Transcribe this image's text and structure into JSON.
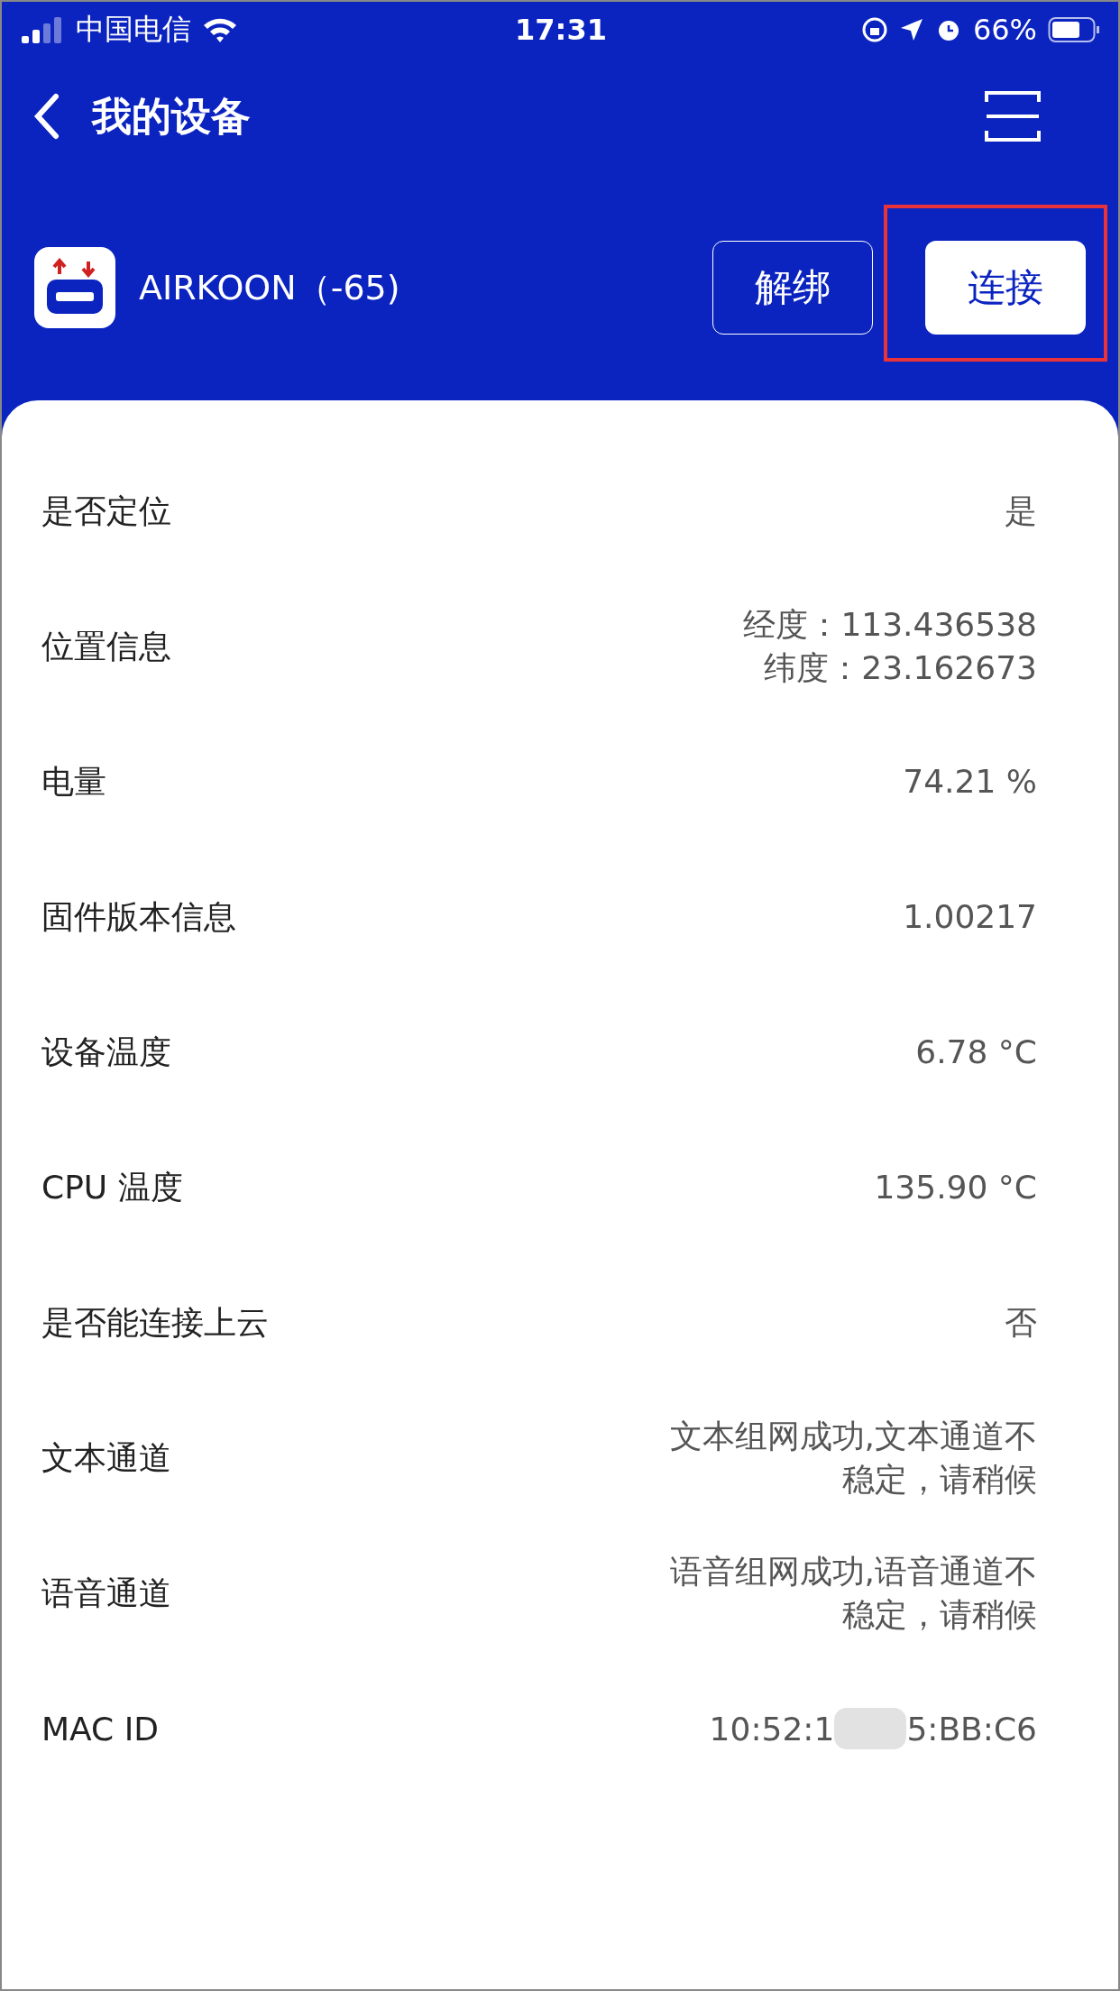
{
  "status_bar": {
    "carrier": "中国电信",
    "time": "17:31",
    "battery": "66%"
  },
  "nav": {
    "title": "我的设备"
  },
  "device": {
    "name": "AIRKOON（-65)",
    "buttons": [
      {
        "label": "解绑",
        "kind": "outline",
        "highlighted": false
      },
      {
        "label": "连接",
        "kind": "filled",
        "highlighted": true
      }
    ]
  },
  "rows": [
    {
      "label": "是否定位",
      "value": [
        "是"
      ]
    },
    {
      "label": "位置信息",
      "value": [
        "经度：113.436538",
        "纬度：23.162673"
      ]
    },
    {
      "label": "电量",
      "value": [
        "74.21 %"
      ]
    },
    {
      "label": "固件版本信息",
      "value": [
        "1.00217"
      ]
    },
    {
      "label": "设备温度",
      "value": [
        "6.78 °C"
      ]
    },
    {
      "label": "CPU 温度",
      "value": [
        "135.90 °C"
      ]
    },
    {
      "label": "是否能连接上云",
      "value": [
        "否"
      ]
    },
    {
      "label": "文本通道",
      "value": [
        "文本组网成功,文本通道不",
        "稳定，请稍候"
      ]
    },
    {
      "label": "语音通道",
      "value": [
        "语音组网成功,语音通道不",
        "稳定，请稍候"
      ]
    },
    {
      "label": "MAC ID",
      "value": [
        "10:52:1",
        "5:BB:C6"
      ],
      "redacted": true
    }
  ]
}
